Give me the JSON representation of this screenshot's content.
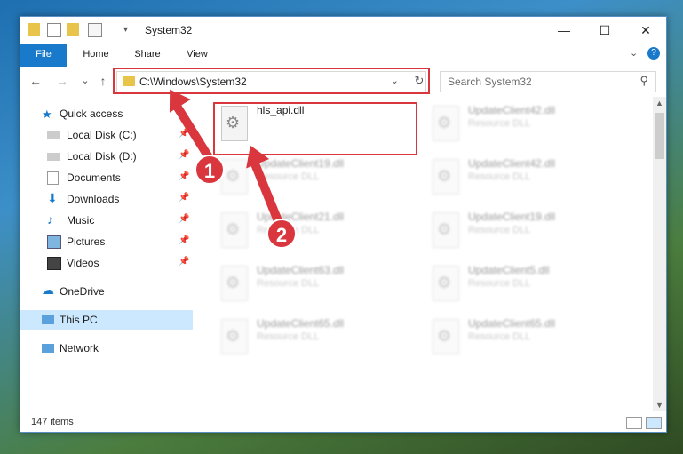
{
  "window": {
    "title": "System32",
    "minimize": "—",
    "maximize": "☐",
    "close": "✕",
    "help": "?",
    "collapse": "⌄"
  },
  "ribbon": {
    "tabs": [
      "File",
      "Home",
      "Share",
      "View"
    ]
  },
  "nav": {
    "back": "←",
    "forward": "→",
    "recent": "⌄",
    "up": "↑",
    "address_path": "C:\\Windows\\System32",
    "address_dropdown": "⌄",
    "refresh": "↻",
    "search_placeholder": "Search System32",
    "search_icon": "⚲"
  },
  "sidebar": {
    "items": [
      {
        "label": "Quick access",
        "icon": "star-icon",
        "pinned": false
      },
      {
        "label": "Local Disk (C:)",
        "icon": "drive-icon",
        "pinned": true
      },
      {
        "label": "Local Disk (D:)",
        "icon": "drive-icon",
        "pinned": true
      },
      {
        "label": "Documents",
        "icon": "documents-icon",
        "pinned": true
      },
      {
        "label": "Downloads",
        "icon": "downloads-icon",
        "pinned": true
      },
      {
        "label": "Music",
        "icon": "music-icon",
        "pinned": true
      },
      {
        "label": "Pictures",
        "icon": "pictures-icon",
        "pinned": true
      },
      {
        "label": "Videos",
        "icon": "videos-icon",
        "pinned": true
      },
      {
        "label": "OneDrive",
        "icon": "cloud-icon",
        "pinned": false
      },
      {
        "label": "This PC",
        "icon": "computer-icon",
        "pinned": false
      },
      {
        "label": "Network",
        "icon": "network-icon",
        "pinned": false
      }
    ],
    "pin_glyph": "📌"
  },
  "files": {
    "left": [
      {
        "name": "hls_api.dll",
        "type": ""
      },
      {
        "name": "UpdateClient19.dll",
        "type": "Resource DLL"
      },
      {
        "name": "UpdateClient21.dll",
        "type": "Resource DLL"
      },
      {
        "name": "UpdateClient63.dll",
        "type": "Resource DLL"
      },
      {
        "name": "UpdateClient65.dll",
        "type": "Resource DLL"
      }
    ],
    "right": [
      {
        "name": "UpdateClient42.dll",
        "type": "Resource DLL"
      },
      {
        "name": "UpdateClient42.dll",
        "type": "Resource DLL"
      },
      {
        "name": "UpdateClient19.dll",
        "type": "Resource DLL"
      },
      {
        "name": "UpdateClient5.dll",
        "type": "Resource DLL"
      },
      {
        "name": "UpdateClient65.dll",
        "type": "Resource DLL"
      }
    ]
  },
  "status": {
    "item_count": "147 items"
  },
  "annotations": {
    "marker1": "1",
    "marker2": "2",
    "color": "#d9363e"
  }
}
